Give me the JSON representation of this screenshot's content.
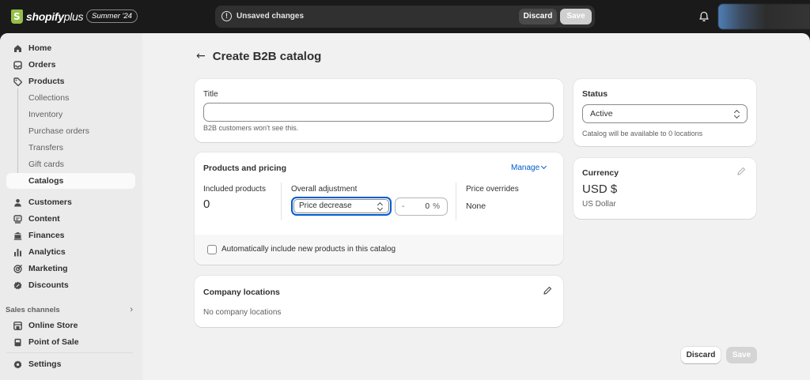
{
  "topbar": {
    "logo_bold": "shopify",
    "logo_light": "plus",
    "edition": "Summer '24",
    "unsaved_text": "Unsaved changes",
    "discard_label": "Discard",
    "save_label": "Save"
  },
  "sidebar": {
    "items": [
      {
        "label": "Home",
        "icon": "home-icon"
      },
      {
        "label": "Orders",
        "icon": "inbox-icon"
      },
      {
        "label": "Products",
        "icon": "tag-icon"
      },
      {
        "label": "Collections"
      },
      {
        "label": "Inventory"
      },
      {
        "label": "Purchase orders"
      },
      {
        "label": "Transfers"
      },
      {
        "label": "Gift cards"
      },
      {
        "label": "Catalogs"
      },
      {
        "label": "Customers",
        "icon": "person-icon"
      },
      {
        "label": "Content",
        "icon": "content-icon"
      },
      {
        "label": "Finances",
        "icon": "bank-icon"
      },
      {
        "label": "Analytics",
        "icon": "bar-chart-icon"
      },
      {
        "label": "Marketing",
        "icon": "target-icon"
      },
      {
        "label": "Discounts",
        "icon": "discount-icon"
      }
    ],
    "sales_channels_label": "Sales channels",
    "channels": [
      {
        "label": "Online Store",
        "icon": "store-icon"
      },
      {
        "label": "Point of Sale",
        "icon": "pos-icon"
      }
    ],
    "settings_label": "Settings"
  },
  "page": {
    "back_glyph": "←",
    "title": "Create B2B catalog"
  },
  "title_card": {
    "label": "Title",
    "value": "",
    "help": "B2B customers won't see this."
  },
  "pricing_card": {
    "title": "Products and pricing",
    "manage": "Manage",
    "included_label": "Included products",
    "included_value": "0",
    "adjustment_label": "Overall adjustment",
    "adjustment_mode": "Price decrease",
    "adjustment_sign": "-",
    "adjustment_value": "0",
    "adjustment_unit": "%",
    "overrides_label": "Price overrides",
    "overrides_value": "None",
    "auto_include_label": "Automatically include new products in this catalog",
    "auto_include_checked": false
  },
  "locations_card": {
    "title": "Company locations",
    "empty": "No company locations"
  },
  "status_card": {
    "title": "Status",
    "value": "Active",
    "help": "Catalog will be available to 0 locations"
  },
  "currency_card": {
    "title": "Currency",
    "code": "USD $",
    "name": "US Dollar"
  },
  "footer": {
    "discard_label": "Discard",
    "save_label": "Save"
  },
  "colors": {
    "accent": "#005bd3",
    "brand": "#95bf47",
    "topbar_bg": "#1a1a1a"
  }
}
